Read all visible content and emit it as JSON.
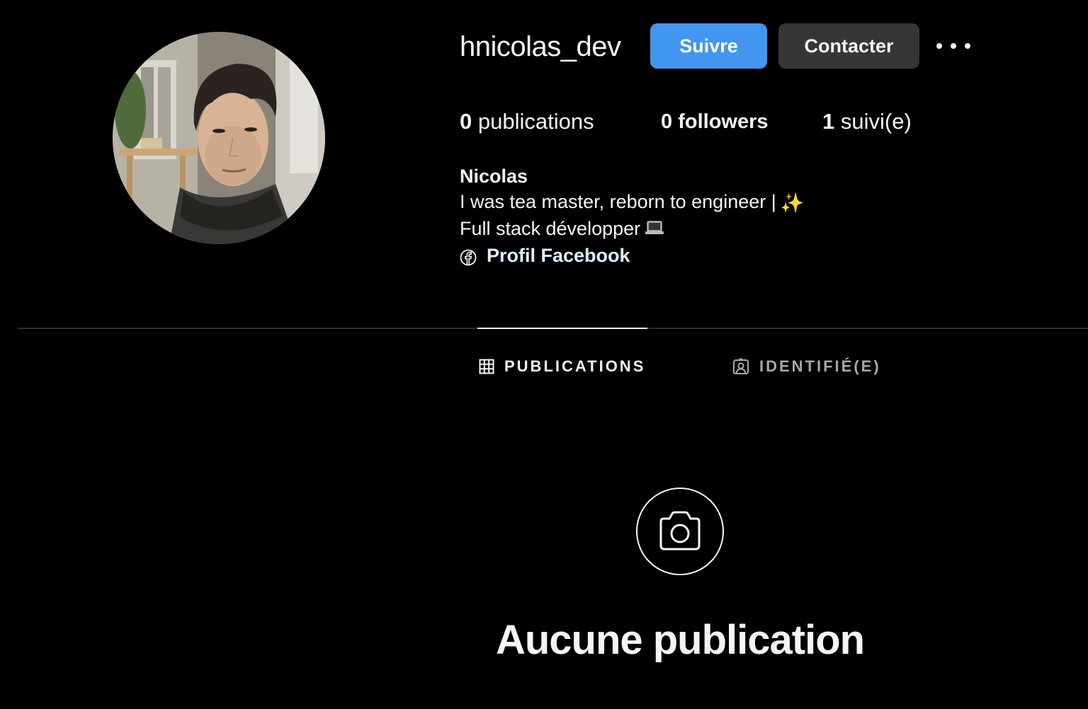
{
  "profile": {
    "username": "hnicolas_dev",
    "follow_label": "Suivre",
    "contact_label": "Contacter",
    "more_icon": "more-horizontal-icon",
    "avatar_alt": "profile photo"
  },
  "stats": {
    "posts_count": "0",
    "posts_label": "publications",
    "followers_count": "0",
    "followers_label": "followers",
    "following_count": "1",
    "following_label": "suivi(e)"
  },
  "bio": {
    "name": "Nicolas",
    "line1": "I was tea master, reborn to engineer |",
    "line1_emoji": "✨",
    "line2": "Full stack développer",
    "line2_emoji": "💻",
    "link_label": "Profil Facebook",
    "link_icon": "facebook-icon"
  },
  "tabs": [
    {
      "label": "PUBLICATIONS",
      "icon": "grid-icon",
      "active": true
    },
    {
      "label": "IDENTIFIÉ(E)",
      "icon": "tagged-user-icon",
      "active": false
    }
  ],
  "empty_state": {
    "icon": "camera-icon",
    "title": "Aucune publication"
  },
  "colors": {
    "background": "#000000",
    "follow_button": "#4396f0",
    "contact_button": "#363636",
    "link": "#e0f1ff",
    "inactive_tab": "#a8a8a8"
  }
}
